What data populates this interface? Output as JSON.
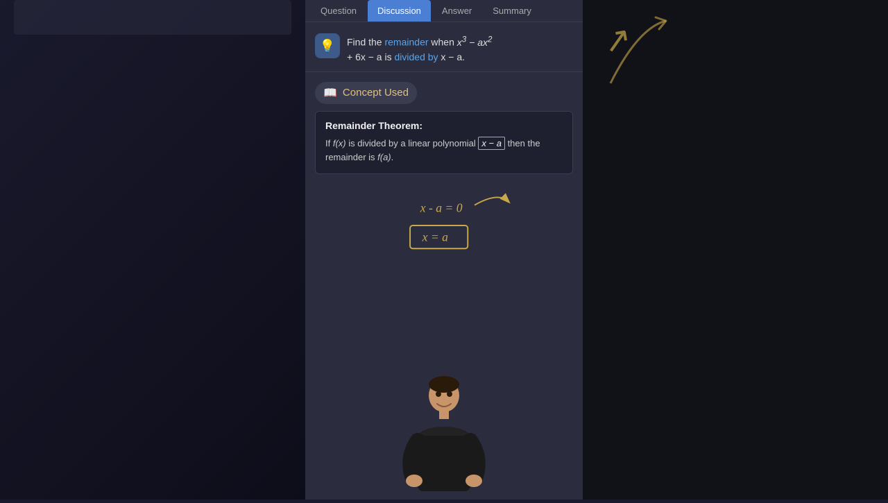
{
  "tabs": [
    {
      "label": "Question",
      "active": false
    },
    {
      "label": "Discussion",
      "active": true
    },
    {
      "label": "Answer",
      "active": false
    },
    {
      "label": "Summary",
      "active": false
    }
  ],
  "question": {
    "text_prefix": "Find the ",
    "highlight1": "remainder",
    "text_mid": " when ",
    "math_expr": "x³ − ax²",
    "text_line2": "+ 6x − a is ",
    "highlight2": "divided by",
    "text_suffix": " x − a."
  },
  "concept": {
    "section_label": "Concept Used",
    "theorem_title": "Remainder Theorem:",
    "theorem_text_1": "If ",
    "theorem_math1": "f(x)",
    "theorem_text_2": " is divided by a linear polynomial ",
    "theorem_boxed": "x − a",
    "theorem_text_3": " then the remainder is ",
    "theorem_math2": "f(a)",
    "theorem_text_4": "."
  },
  "annotation": {
    "line1": "x - a = 0",
    "line2": "x = a"
  },
  "colors": {
    "active_tab_bg": "#4a7fd4",
    "highlight_blue": "#5ba3e8",
    "accent_yellow": "#c8a84b",
    "bg_dark": "#2b2d3e"
  }
}
